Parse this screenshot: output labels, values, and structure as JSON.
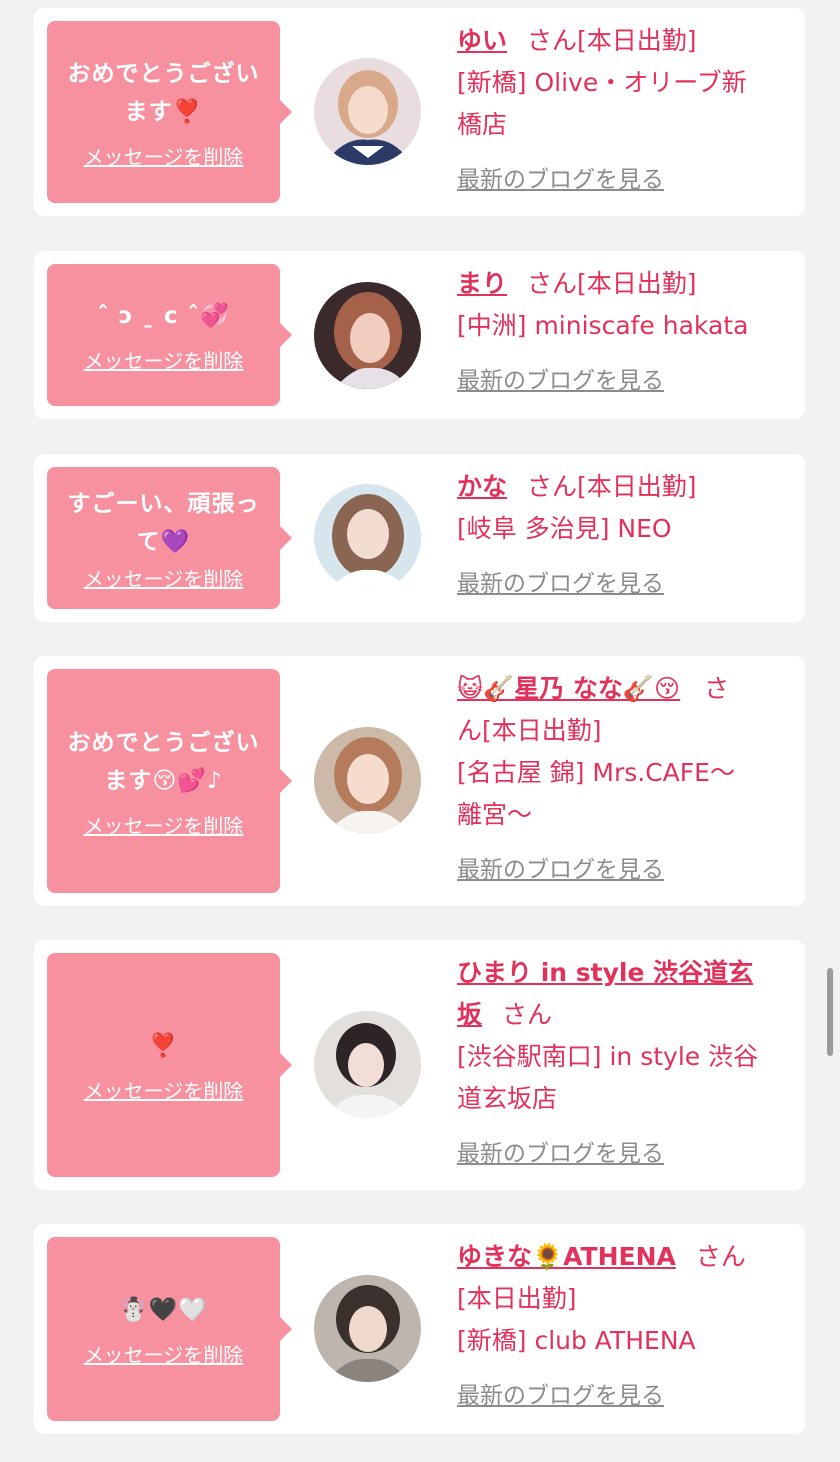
{
  "delete_label": "メッセージを削除",
  "blog_label": "最新のブログを見る",
  "accent_color": "#e2315b",
  "bubble_color": "#f7919f",
  "cards": [
    {
      "message_lines": [
        "おめでとうござい",
        "ます❣️"
      ],
      "name": "ゆい",
      "suffix": "さん[本日出勤]",
      "shop_lines": [
        "[新橋] Olive・オリーブ新",
        "橋店"
      ]
    },
    {
      "message_lines": [
        "ˆ ɔ ˍ c ˆ💞"
      ],
      "name": "まり",
      "suffix": "さん[本日出勤]",
      "shop_lines": [
        "[中洲] miniscafe hakata"
      ]
    },
    {
      "message_lines": [
        "すごーい、頑張っ",
        "て💜"
      ],
      "name": "かな",
      "suffix": "さん[本日出勤]",
      "shop_lines": [
        "[岐阜 多治見] NEO"
      ]
    },
    {
      "message_lines": [
        "おめでとうござい",
        "ます😚💕♪"
      ],
      "name_lines": [
        "😺🎸星乃 なな🎸😚"
      ],
      "suffix_lines": [
        "さ",
        "ん[本日出勤]"
      ],
      "shop_lines": [
        "[名古屋 錦] Mrs.CAFE～",
        "離宮～"
      ]
    },
    {
      "message_lines": [
        "❣️"
      ],
      "name_lines": [
        "ひまり in style 渋谷道玄",
        "坂"
      ],
      "suffix": "さん",
      "shop_lines": [
        "[渋谷駅南口] in style 渋谷",
        "道玄坂店"
      ]
    },
    {
      "message_lines": [
        "☃️🖤🤍"
      ],
      "name": "ゆきな🌻ATHENA",
      "suffix": "さん",
      "status": "[本日出勤]",
      "shop_lines": [
        "[新橋] club ATHENA"
      ]
    }
  ]
}
